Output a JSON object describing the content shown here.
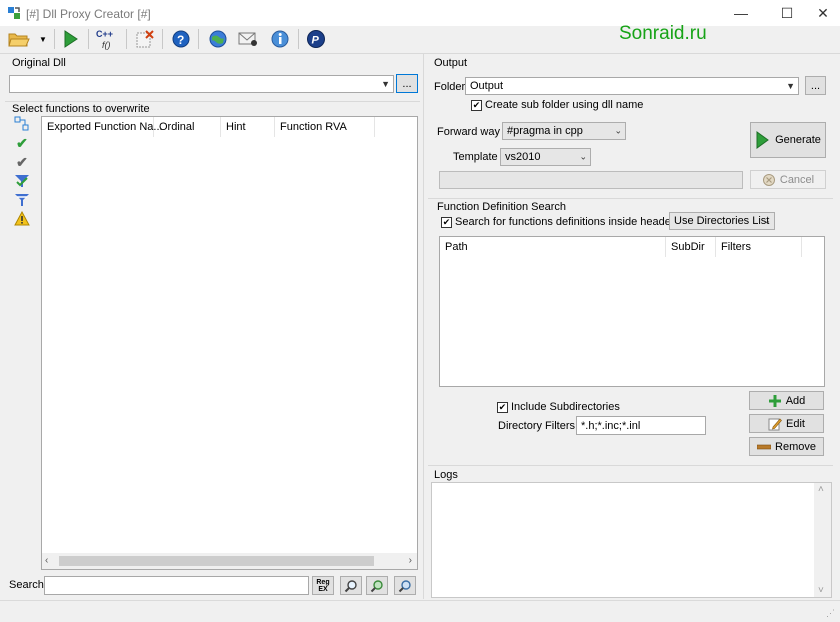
{
  "window": {
    "title": "[#] Dll Proxy Creator [#]",
    "minimize": "—",
    "maximize": "☐",
    "close": "✕"
  },
  "watermark": "Sonraid.ru",
  "original_dll": {
    "label": "Original Dll",
    "value": "",
    "browse_label": "..."
  },
  "functions": {
    "label": "Select functions to overwrite",
    "columns": [
      "Exported Function Na...",
      "Ordinal",
      "Hint",
      "Function RVA"
    ],
    "search_label": "Search",
    "search_value": "",
    "regex_top": "Reg",
    "regex_bottom": "EX"
  },
  "output": {
    "label": "Output",
    "folder_label": "Folder",
    "folder_value": "Output",
    "browse_label": "...",
    "subfolder_checked": true,
    "subfolder_label": "Create sub folder using dll name",
    "forward_way_label": "Forward way",
    "forward_way_value": "#pragma in cpp",
    "template_label": "Template",
    "template_value": "vs2010",
    "generate_label": "Generate",
    "cancel_label": "Cancel"
  },
  "search_defs": {
    "label": "Function Definition Search",
    "search_checked": true,
    "search_label": "Search for functions definitions inside headers",
    "mode_value": "Use Directories List",
    "columns": [
      "Path",
      "SubDir",
      "Filters"
    ],
    "include_checked": true,
    "include_label": "Include  Subdirectories",
    "dir_filters_label": "Directory Filters",
    "dir_filters_value": "*.h;*.inc;*.inl",
    "add_label": "Add",
    "edit_label": "Edit",
    "remove_label": "Remove"
  },
  "logs": {
    "label": "Logs"
  }
}
